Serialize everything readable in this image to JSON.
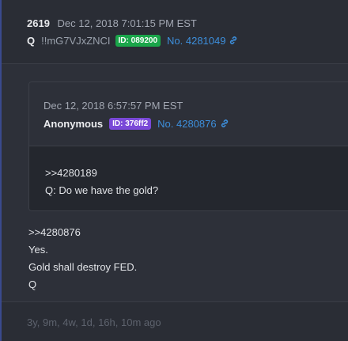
{
  "post": {
    "number": "2619",
    "date": "Dec 12, 2018 7:01:15 PM EST",
    "author": "Q",
    "tripcode": "!!mG7VJxZNCI",
    "id_badge": "ID: 089200",
    "post_no": "No. 4281049",
    "body": [
      ">>4280876",
      "Yes.",
      "Gold shall destroy FED.",
      "Q"
    ],
    "relative_time": "3y, 9m, 4w, 1d, 16h, 10m ago"
  },
  "quoted_post": {
    "date": "Dec 12, 2018 6:57:57 PM EST",
    "author": "Anonymous",
    "id_badge": "ID: 376ff2",
    "post_no": "No. 4280876",
    "body": [
      ">>4280189",
      "Q: Do we have the gold?"
    ]
  },
  "colors": {
    "accent_link": "#3d8fdc",
    "id_green": "#1aa64a",
    "id_purple": "#7a48d8",
    "left_border": "#3a4a8d"
  },
  "icons": {
    "permalink": "link-icon"
  }
}
